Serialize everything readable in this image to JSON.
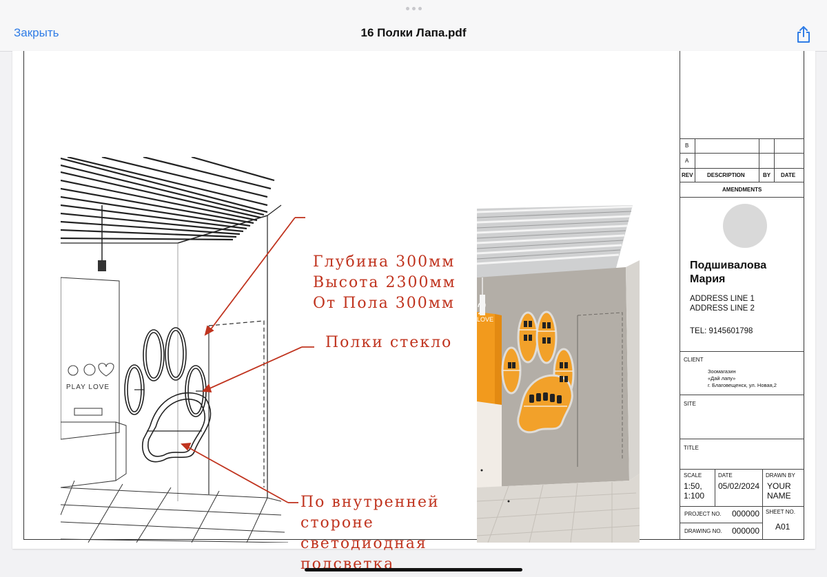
{
  "topbar": {
    "close_label": "Закрыть",
    "title": "16 Полки Лапа.pdf",
    "share_icon": "share-icon"
  },
  "drawing": {
    "labels": {
      "depth": "Глубина 300мм",
      "height": "Высота 2300мм",
      "from_floor": "От Пола 300мм",
      "shelves": "Полки стекло",
      "inner_1": "По внутренней",
      "inner_2": "стороне",
      "inner_3": "светодиодная",
      "inner_4": "подсветка"
    },
    "logo_text": "PLAY LOVE",
    "logo_text_right": "LOVE"
  },
  "title_block": {
    "rev_b": "B",
    "rev_a": "A",
    "col_rev": "REV",
    "col_description": "DESCRIPTION",
    "col_by": "BY",
    "col_date": "DATE",
    "amendments": "AMENDMENTS",
    "name_line1": "Подшивалова",
    "name_line2": "Мария",
    "address_line1": "ADDRESS LINE 1",
    "address_line2": "ADDRESS LINE 2",
    "tel": "TEL: 9145601798",
    "client_label": "CLIENT",
    "client_line1": "Зоомагазин",
    "client_line2": "«Дай лапу»",
    "client_line3": "г. Благовещенск, ул. Новая,2",
    "site_label": "SITE",
    "title_label": "TITLE",
    "scale_label": "SCALE",
    "scale_value_1": "1:50,",
    "scale_value_2": "1:100",
    "date_label": "DATE",
    "date_value": "05/02/2024",
    "drawn_by_label": "DRAWN BY",
    "drawn_by_value_1": "YOUR",
    "drawn_by_value_2": "NAME",
    "project_no_label": "PROJECT NO.",
    "project_no_value": "000000",
    "sheet_no_label": "SHEET NO.",
    "sheet_no_value": "A01",
    "drawing_no_label": "DRAWING NO.",
    "drawing_no_value": "000000"
  },
  "colors": {
    "accent": "#2f7ce6",
    "annotation": "#c0341f",
    "orange": "#f3a020"
  }
}
